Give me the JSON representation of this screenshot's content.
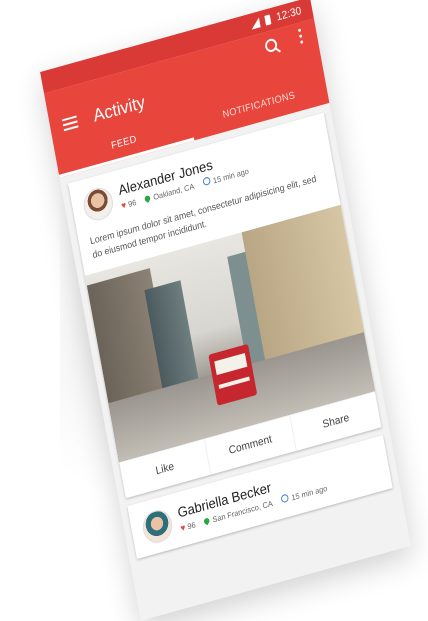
{
  "status_bar": {
    "time": "12:30"
  },
  "app_bar": {
    "title": "Activity",
    "tabs": [
      {
        "label": "FEED",
        "active": true
      },
      {
        "label": "NOTIFICATIONS",
        "active": false
      }
    ]
  },
  "posts": [
    {
      "author": "Alexander Jones",
      "likes": "96",
      "location": "Oakland, CA",
      "time": "15 min ago",
      "text": "Lorem ipsum dolor sit amet, consectetur adipisicing elit, sed do eiusmod tempor incididunt.",
      "actions": [
        "Like",
        "Comment",
        "Share"
      ]
    },
    {
      "author": "Gabriella Becker",
      "likes": "96",
      "location": "San Francisco, CA",
      "time": "15 min ago"
    }
  ],
  "colors": {
    "primary": "#e8453c",
    "status_bar": "#d93a35",
    "like": "#e8453c",
    "location": "#29a745",
    "time": "#3a7bd5"
  },
  "icons": [
    "menu-icon",
    "search-icon",
    "more-vert-icon",
    "heart-icon",
    "location-pin-icon",
    "clock-icon"
  ]
}
